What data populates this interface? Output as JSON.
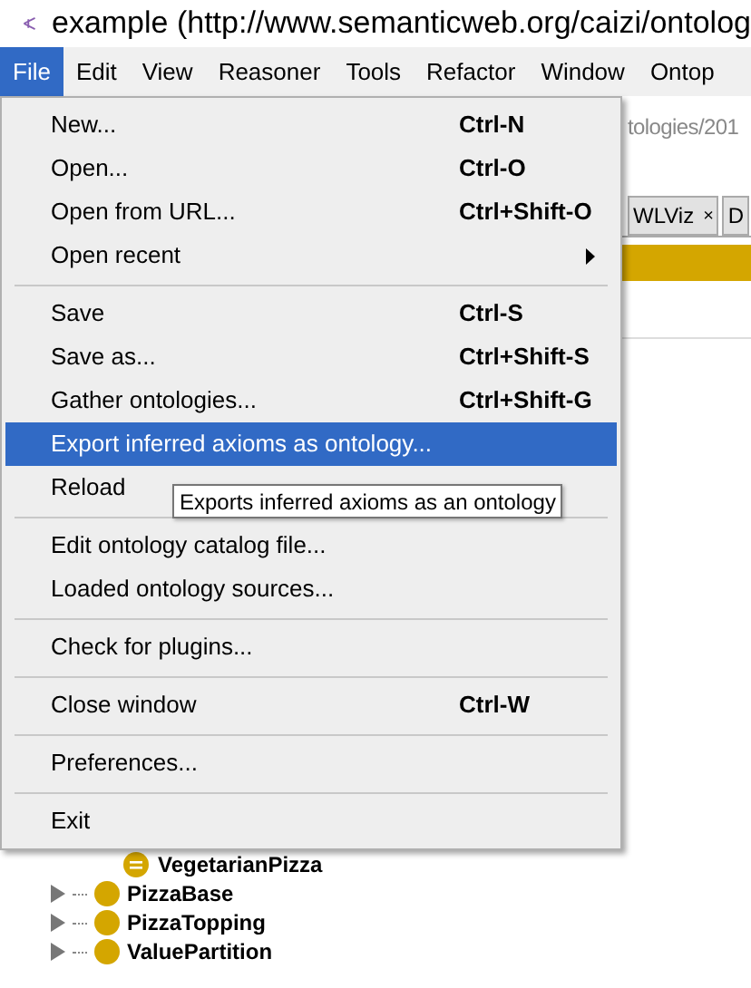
{
  "window": {
    "title": "example (http://www.semanticweb.org/caizi/ontolog"
  },
  "menubar": [
    {
      "label": "File",
      "selected": true
    },
    {
      "label": "Edit",
      "selected": false
    },
    {
      "label": "View",
      "selected": false
    },
    {
      "label": "Reasoner",
      "selected": false
    },
    {
      "label": "Tools",
      "selected": false
    },
    {
      "label": "Refactor",
      "selected": false
    },
    {
      "label": "Window",
      "selected": false
    },
    {
      "label": "Ontop",
      "selected": false
    }
  ],
  "file_menu": [
    {
      "kind": "item",
      "label": "New...",
      "shortcut": "Ctrl-N",
      "selected": false
    },
    {
      "kind": "item",
      "label": "Open...",
      "shortcut": "Ctrl-O",
      "selected": false
    },
    {
      "kind": "item",
      "label": "Open from URL...",
      "shortcut": "Ctrl+Shift-O",
      "selected": false
    },
    {
      "kind": "submenu",
      "label": "Open recent",
      "selected": false
    },
    {
      "kind": "separator"
    },
    {
      "kind": "item",
      "label": "Save",
      "shortcut": "Ctrl-S",
      "selected": false
    },
    {
      "kind": "item",
      "label": "Save as...",
      "shortcut": "Ctrl+Shift-S",
      "selected": false
    },
    {
      "kind": "item",
      "label": "Gather ontologies...",
      "shortcut": "Ctrl+Shift-G",
      "selected": false
    },
    {
      "kind": "item",
      "label": "Export inferred axioms as ontology...",
      "selected": true
    },
    {
      "kind": "item",
      "label": "Reload",
      "selected": false
    },
    {
      "kind": "separator"
    },
    {
      "kind": "item",
      "label": "Edit ontology catalog file...",
      "selected": false
    },
    {
      "kind": "item",
      "label": "Loaded ontology sources...",
      "selected": false
    },
    {
      "kind": "separator"
    },
    {
      "kind": "item",
      "label": "Check for plugins...",
      "selected": false
    },
    {
      "kind": "separator"
    },
    {
      "kind": "item",
      "label": "Close window",
      "shortcut": "Ctrl-W",
      "selected": false
    },
    {
      "kind": "separator"
    },
    {
      "kind": "item",
      "label": "Preferences...",
      "selected": false
    },
    {
      "kind": "separator"
    },
    {
      "kind": "item",
      "label": "Exit",
      "selected": false
    }
  ],
  "tooltip": "Exports inferred axioms as an ontology",
  "address": "tologies/201",
  "tabs": [
    {
      "label": "WLViz",
      "close": "×"
    },
    {
      "label": "D"
    }
  ],
  "tree": {
    "nested": [
      {
        "label": "VegetarianPizza",
        "kind": "defined"
      }
    ],
    "items": [
      {
        "label": "PizzaBase",
        "kind": "class",
        "expanded": false
      },
      {
        "label": "PizzaTopping",
        "kind": "class",
        "expanded": false
      },
      {
        "label": "ValuePartition",
        "kind": "class",
        "expanded": false
      }
    ]
  }
}
